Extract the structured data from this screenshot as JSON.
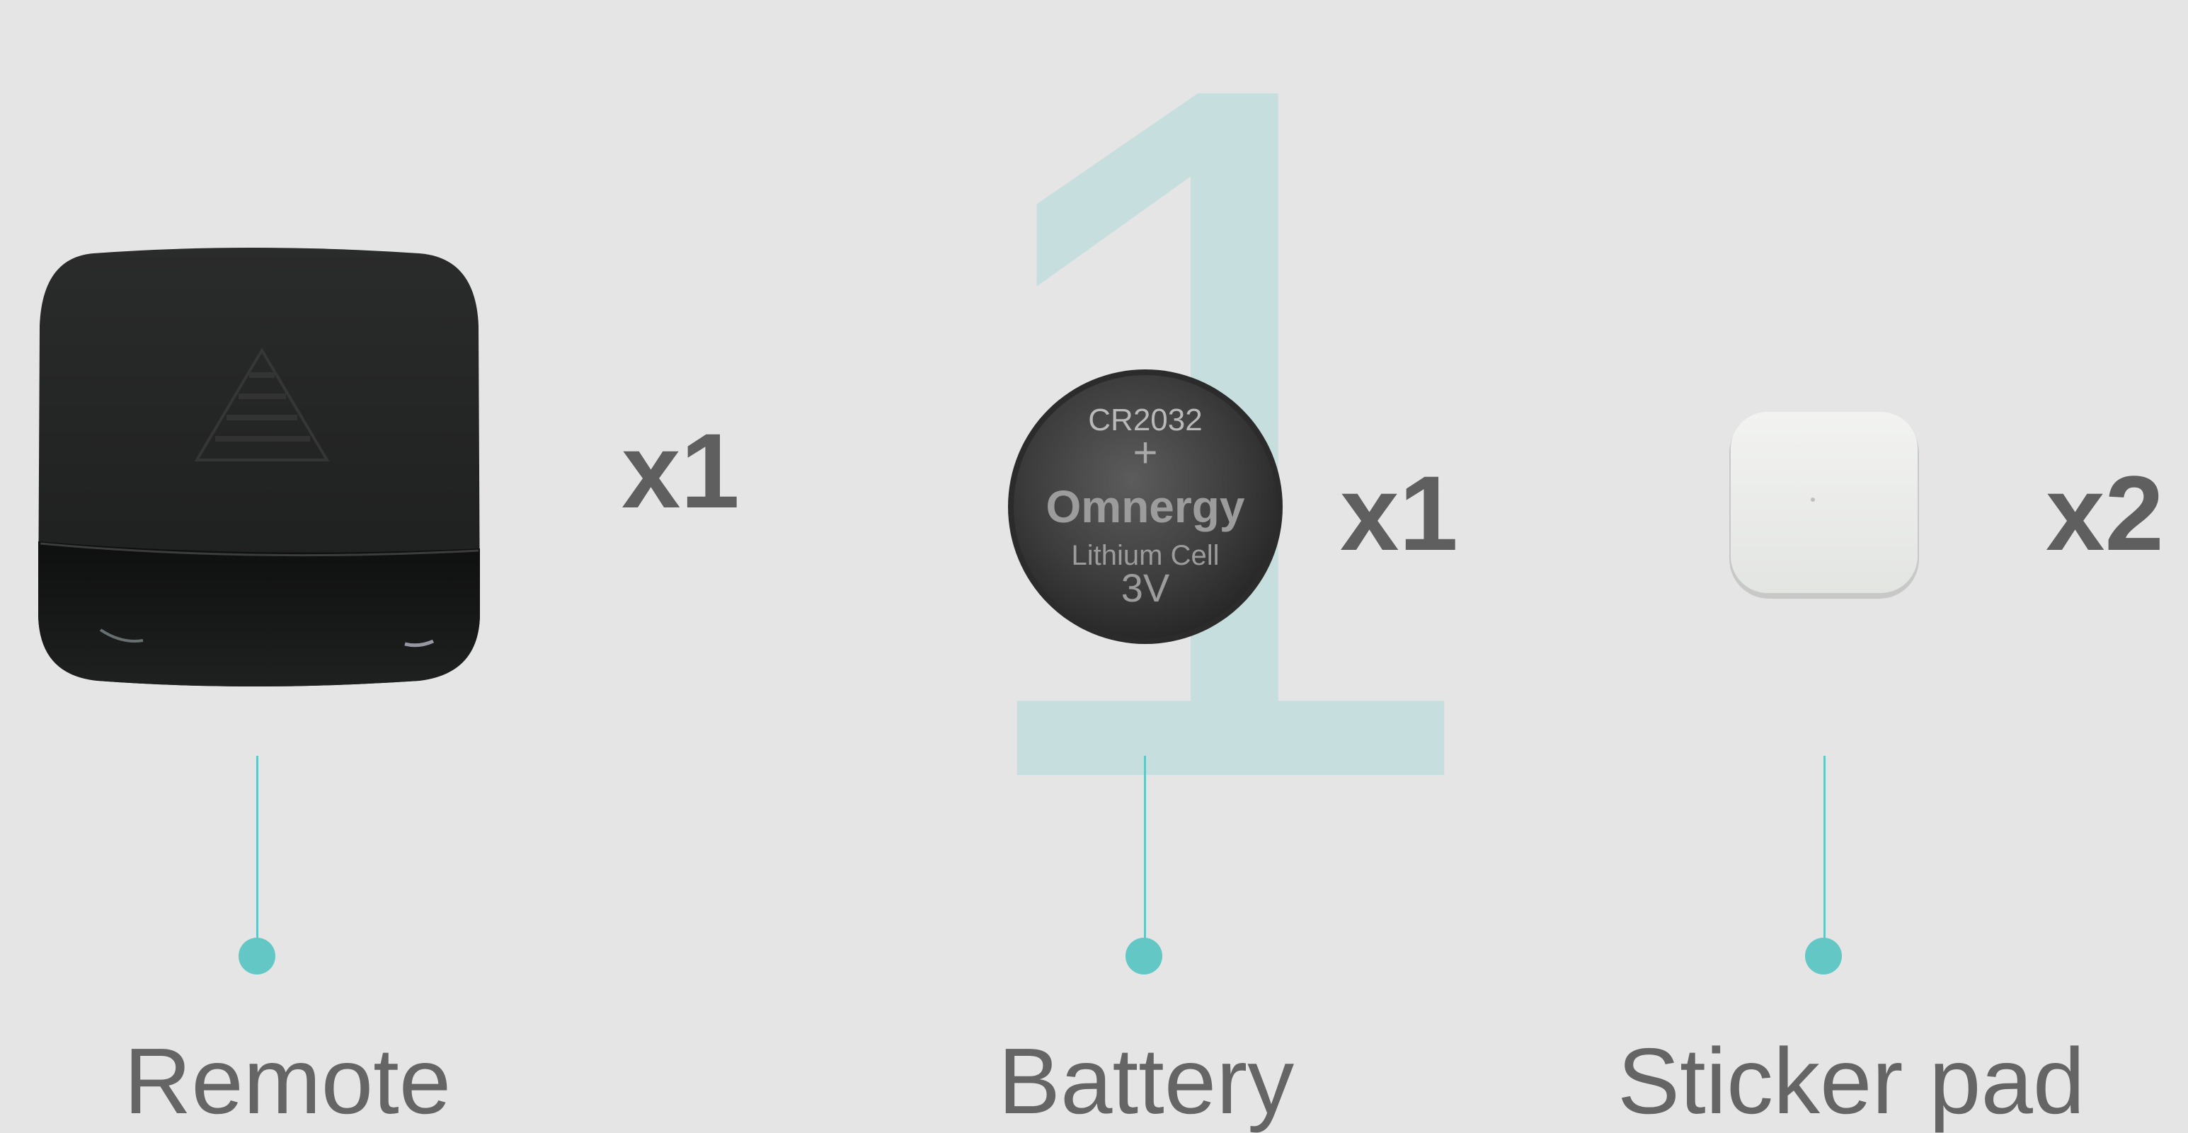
{
  "step": {
    "number": "1"
  },
  "items": [
    {
      "name": "Remote",
      "quantity": "x1"
    },
    {
      "name": "Battery",
      "quantity": "x1",
      "battery_print": {
        "model": "CR2032",
        "polarity": "+",
        "brand": "Omnergy",
        "type": "Lithium Cell",
        "voltage": "3V"
      }
    },
    {
      "name": "Sticker pad",
      "quantity": "x2"
    }
  ],
  "colors": {
    "accent": "#63c7c5",
    "background": "#e5e5e5",
    "step_number": "#c7dede",
    "text": "#656565",
    "quantity": "#5f5f5f"
  }
}
